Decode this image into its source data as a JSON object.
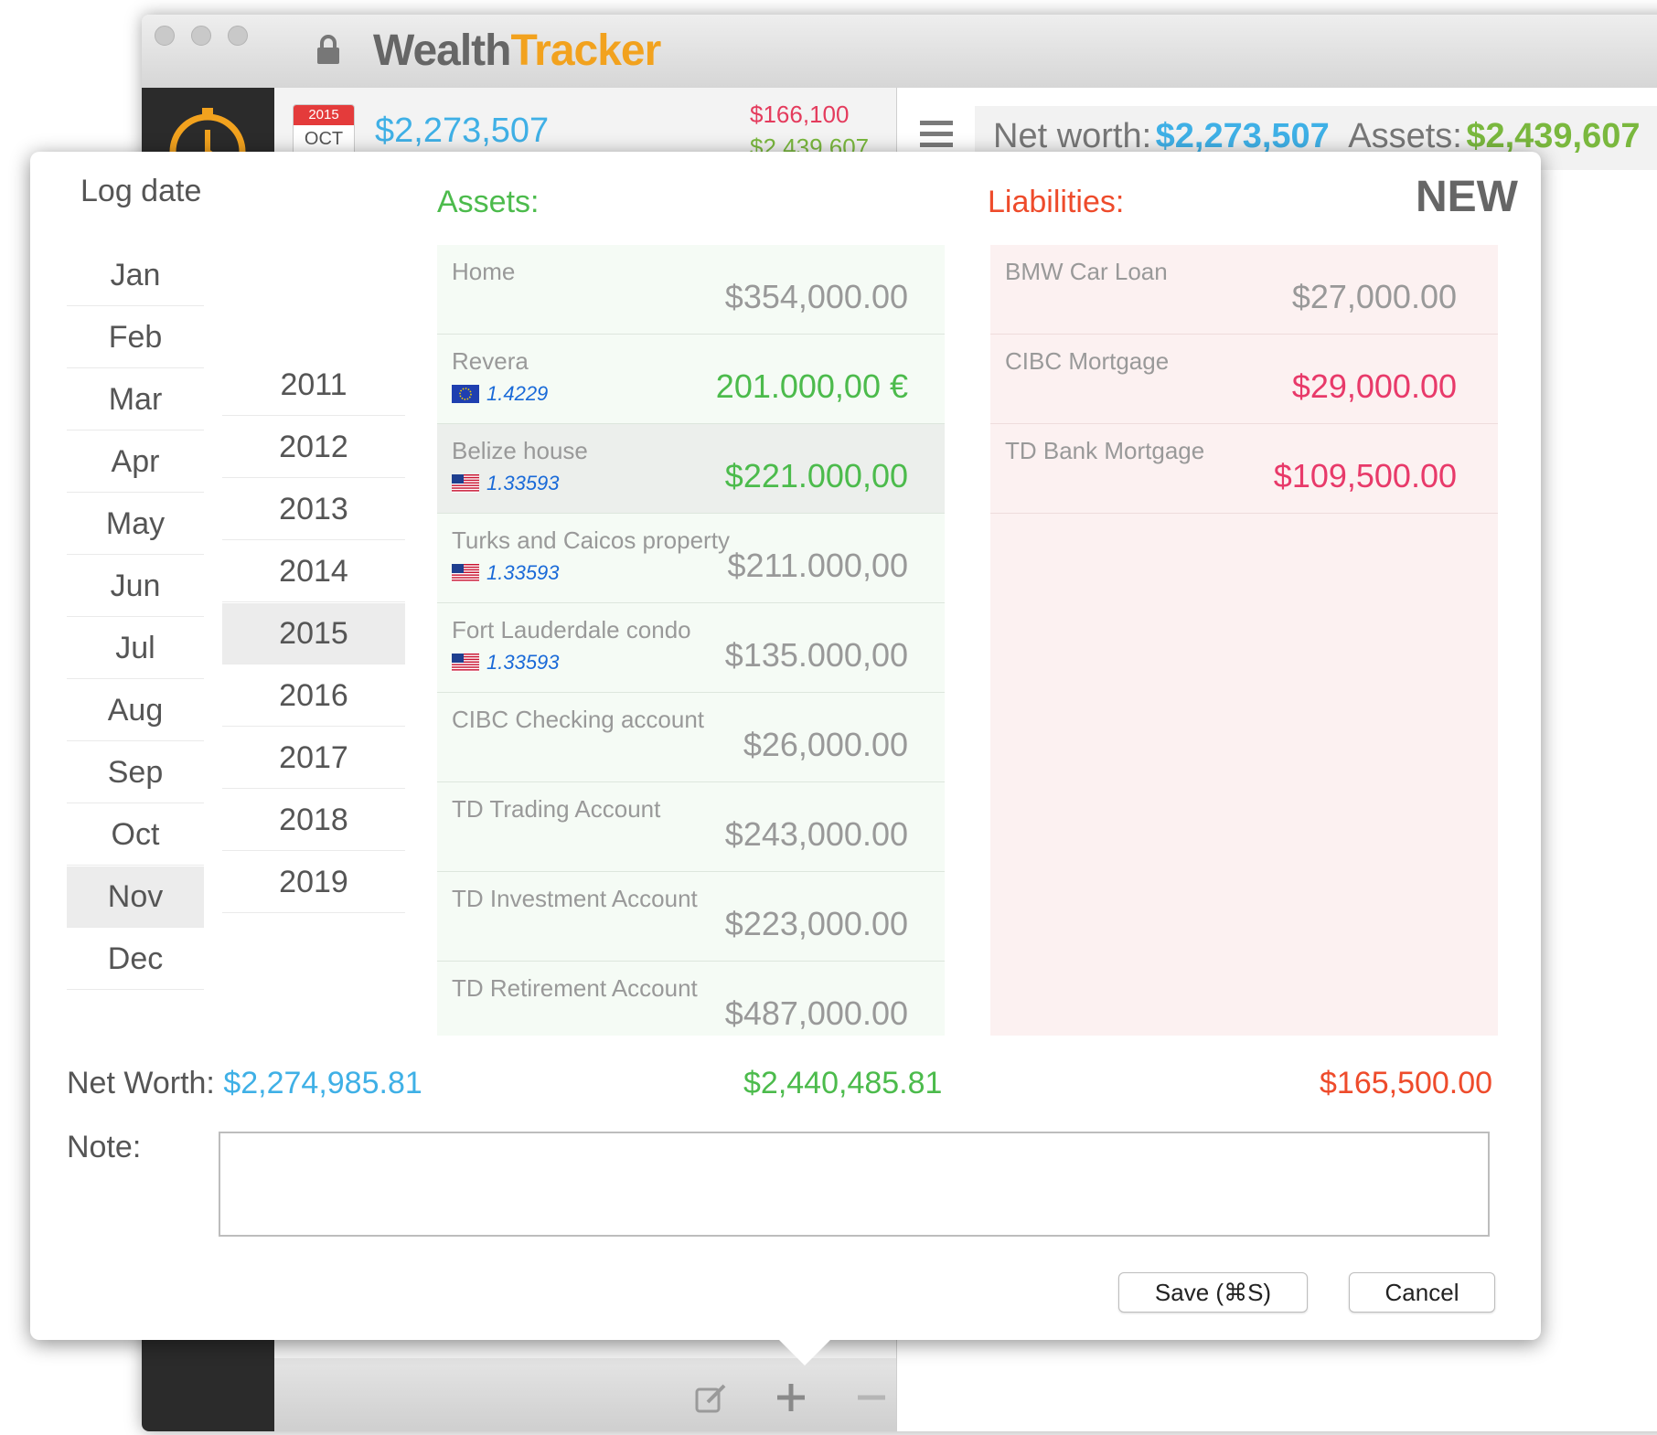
{
  "app": {
    "title_part1": "Wealth",
    "title_part2": "Tracker"
  },
  "list_row": {
    "cal_year": "2015",
    "cal_month": "OCT",
    "net_value": "$2,273,507",
    "liabilities": "$166,100",
    "assets": "$2,439,607"
  },
  "summary": {
    "net_worth_label": "Net worth:",
    "net_worth_value": "$2,273,507",
    "assets_label": "Assets:",
    "assets_value": "$2,439,607"
  },
  "popover": {
    "log_date_label": "Log date",
    "months": [
      "Jan",
      "Feb",
      "Mar",
      "Apr",
      "May",
      "Jun",
      "Jul",
      "Aug",
      "Sep",
      "Oct",
      "Nov",
      "Dec"
    ],
    "selected_month": "Nov",
    "years": [
      "2011",
      "2012",
      "2013",
      "2014",
      "2015",
      "2016",
      "2017",
      "2018",
      "2019"
    ],
    "selected_year": "2015",
    "assets_title": "Assets:",
    "liabilities_title": "Liabilities:",
    "new_label": "NEW",
    "assets": [
      {
        "name": "Home",
        "amount": "$354,000.00",
        "fx": "",
        "flag": "",
        "color": "#999999"
      },
      {
        "name": "Revera",
        "amount": "201.000,00 €",
        "fx": "1.4229",
        "flag": "eu",
        "color": "#4cbb4c"
      },
      {
        "name": "Belize house",
        "amount": "$221.000,00",
        "fx": "1.33593",
        "flag": "us",
        "color": "#4cbb4c"
      },
      {
        "name": "Turks and Caicos property",
        "amount": "$211.000,00",
        "fx": "1.33593",
        "flag": "us",
        "color": "#999999"
      },
      {
        "name": "Fort Lauderdale condo",
        "amount": "$135.000,00",
        "fx": "1.33593",
        "flag": "us",
        "color": "#999999"
      },
      {
        "name": "CIBC Checking account",
        "amount": "$26,000.00",
        "fx": "",
        "flag": "",
        "color": "#999999"
      },
      {
        "name": "TD Trading Account",
        "amount": "$243,000.00",
        "fx": "",
        "flag": "",
        "color": "#999999"
      },
      {
        "name": "TD Investment Account",
        "amount": "$223,000.00",
        "fx": "",
        "flag": "",
        "color": "#999999"
      },
      {
        "name": "TD Retirement Account",
        "amount": "$487,000.00",
        "fx": "",
        "flag": "",
        "color": "#999999"
      }
    ],
    "liabilities": [
      {
        "name": "BMW Car Loan",
        "amount": "$27,000.00",
        "color": "#999999"
      },
      {
        "name": "CIBC Mortgage",
        "amount": "$29,000.00",
        "color": "#e83a6a"
      },
      {
        "name": "TD Bank Mortgage",
        "amount": "$109,500.00",
        "color": "#e83a6a"
      }
    ],
    "net_worth_label": "Net Worth:",
    "net_worth_value": "$2,274,985.81",
    "assets_total": "$2,440,485.81",
    "liabilities_total": "$165,500.00",
    "note_label": "Note:",
    "note_value": "",
    "save_label": "Save  (⌘S)",
    "cancel_label": "Cancel"
  },
  "colors": {
    "accent_blue": "#3fb0e6",
    "assets_green": "#4cbb4c",
    "liabilities_red": "#ee4b2b",
    "brand_orange": "#f2a21e"
  }
}
